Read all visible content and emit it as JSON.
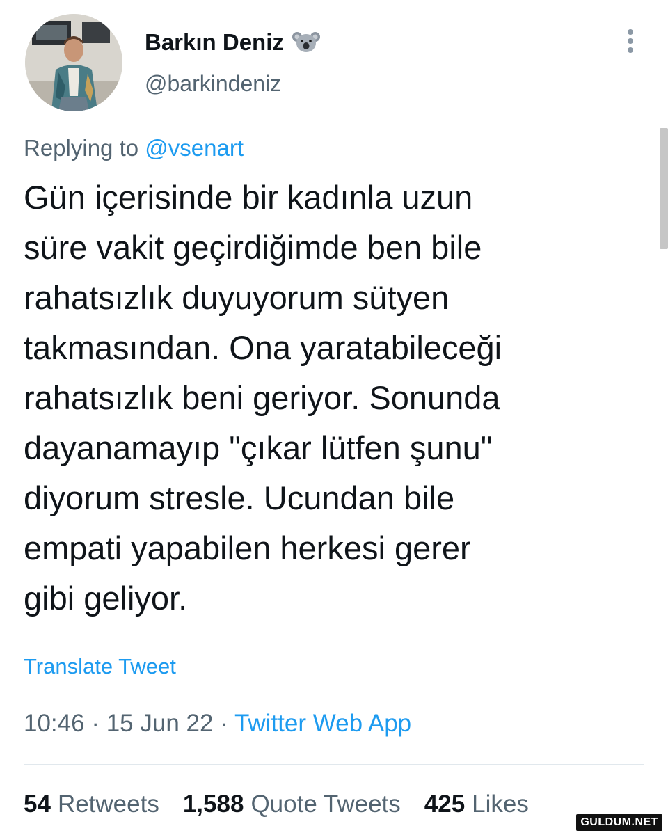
{
  "author": {
    "display_name": "Barkın Deniz",
    "handle": "@barkindeniz",
    "badge_icon": "koala-emoji-icon"
  },
  "reply": {
    "prefix": "Replying to",
    "target": "@vsenart"
  },
  "tweet": {
    "lines": [
      "Gün içerisinde bir kadınla uzun",
      "süre vakit geçirdiğimde ben bile",
      "rahatsızlık duyuyorum sütyen",
      "takmasından. Ona yaratabileceği",
      "rahatsızlık beni geriyor. Sonunda",
      "dayanamayıp \"çıkar lütfen şunu\"",
      "diyorum stresle. Ucundan bile",
      "empati yapabilen herkesi gerer",
      "gibi geliyor."
    ],
    "translate_label": "Translate Tweet"
  },
  "meta": {
    "time": "10:46",
    "date": "15 Jun 22",
    "separator": "·",
    "source": "Twitter Web App"
  },
  "stats": {
    "retweets_count": "54",
    "retweets_label": "Retweets",
    "quotes_count": "1,588",
    "quotes_label": "Quote Tweets",
    "likes_count": "425",
    "likes_label": "Likes"
  },
  "watermark": "GULDUM.NET",
  "colors": {
    "link": "#1d9bf0",
    "secondary_text": "#536471",
    "primary_text": "#0f1419"
  }
}
